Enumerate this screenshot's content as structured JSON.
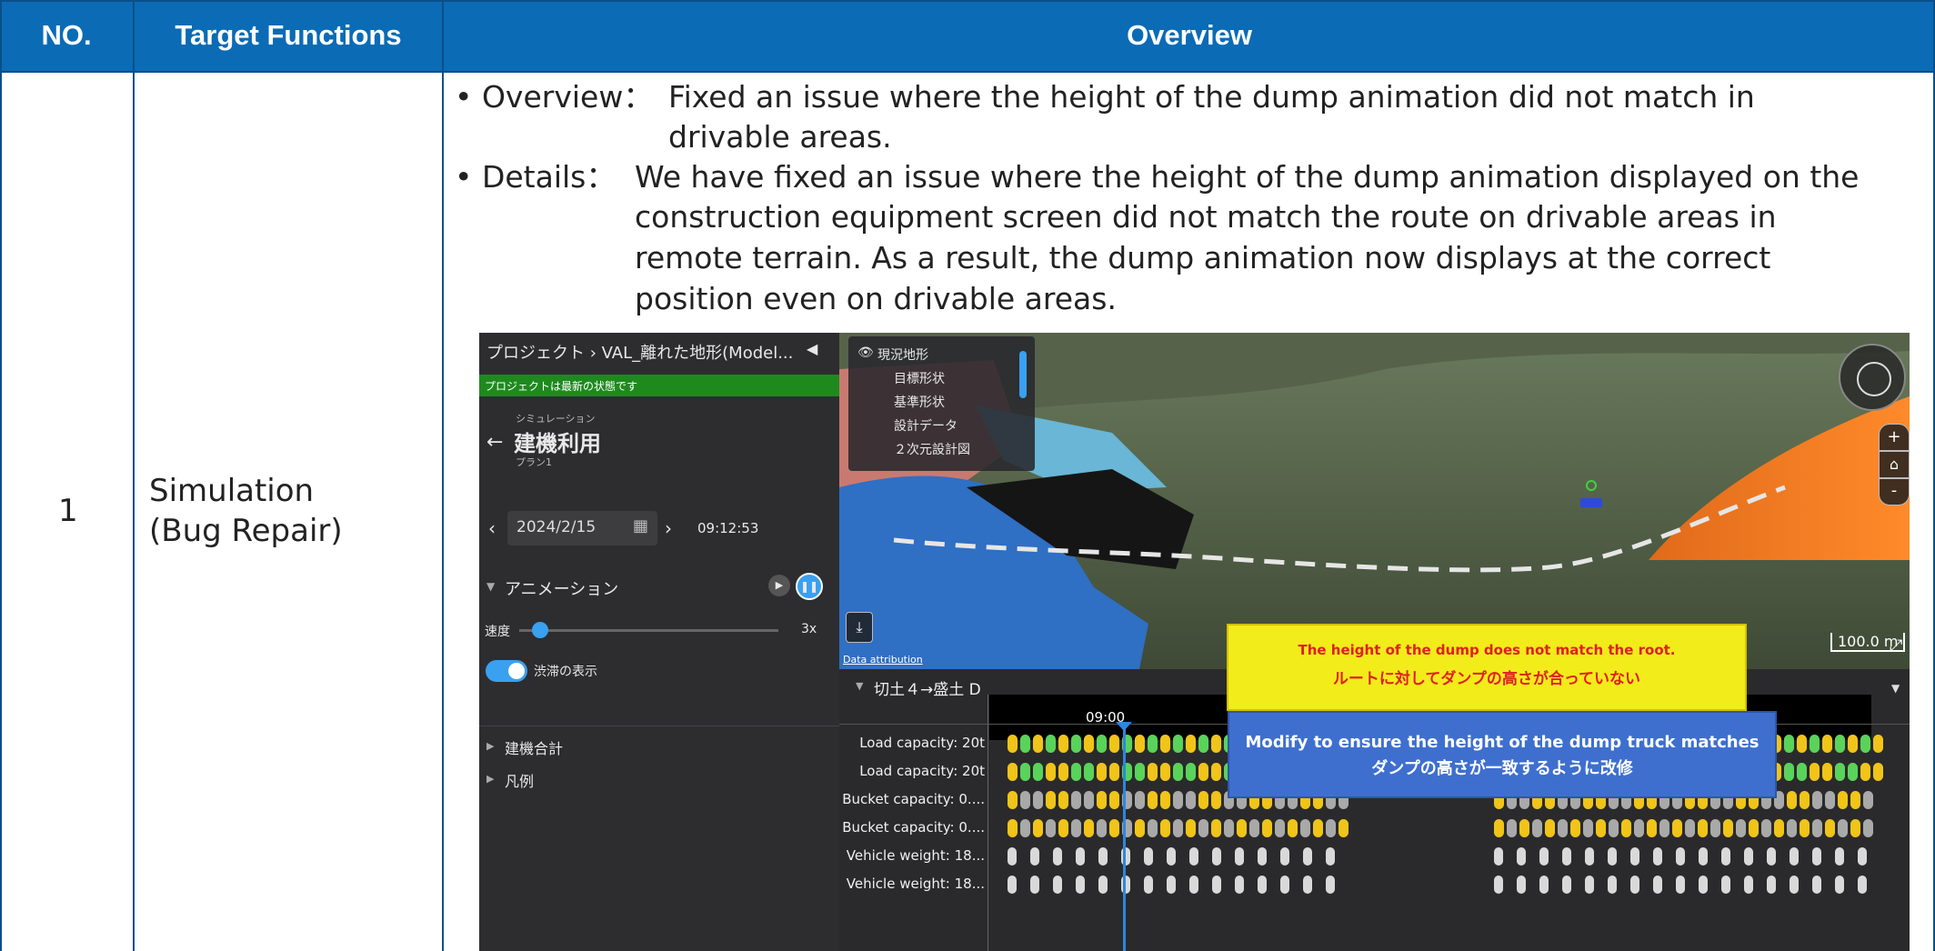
{
  "table": {
    "headers": {
      "no": "NO.",
      "target": "Target Functions",
      "overview": "Overview"
    },
    "row": {
      "no": "1",
      "target_line1": "Simulation",
      "target_line2": "(Bug Repair)",
      "overview_label": "• Overview：",
      "overview_line1": "Fixed an issue where the height of the dump animation did not match in",
      "overview_line2": "drivable areas.",
      "details_label": "• Details：",
      "details_line1": "We have fixed an issue where the height of the dump animation displayed on the",
      "details_line2": "construction equipment screen did not match the route on drivable areas in",
      "details_line3": "remote terrain. As a result, the dump animation now displays at the correct",
      "details_line4": "position even on drivable areas."
    }
  },
  "screenshot": {
    "sidebar": {
      "breadcrumb": "プロジェクト › VAL_離れた地形(Model...",
      "status": "プロジェクトは最新の状態です",
      "section_small": "シミュレーション",
      "title": "建機利用",
      "plan": "プラン1",
      "date": "2024/2/15",
      "time": "09:12:53",
      "animation_label": "アニメーション",
      "speed_label": "速度",
      "speed_value": "3x",
      "congestion_label": "渋滞の表示",
      "group1": "建機合計",
      "group2": "凡例"
    },
    "layers": [
      "現況地形",
      "目標形状",
      "基準形状",
      "設計データ",
      "２次元設計図"
    ],
    "scale": "100.0 m",
    "attribution": "Data attribution",
    "route_title": "切土４→盛土 D",
    "timeline_time": "09:00",
    "rows": [
      "Load capacity: 20t",
      "Load capacity: 20t",
      "Bucket capacity: 0....",
      "Bucket capacity: 0....",
      "Vehicle weight: 18...",
      "Vehicle weight: 18..."
    ],
    "note_yellow_en": "The height of the dump does not match the root.",
    "note_yellow_ja": "ルートに対してダンプの高さが合っていない",
    "note_blue_en": "Modify to ensure the height of the dump truck matches",
    "note_blue_ja": "ダンプの高さが一致するように改修"
  },
  "colors": {
    "header": "#0b6bb5",
    "accent": "#3aa0f0",
    "highlight": "#e31b1b"
  }
}
